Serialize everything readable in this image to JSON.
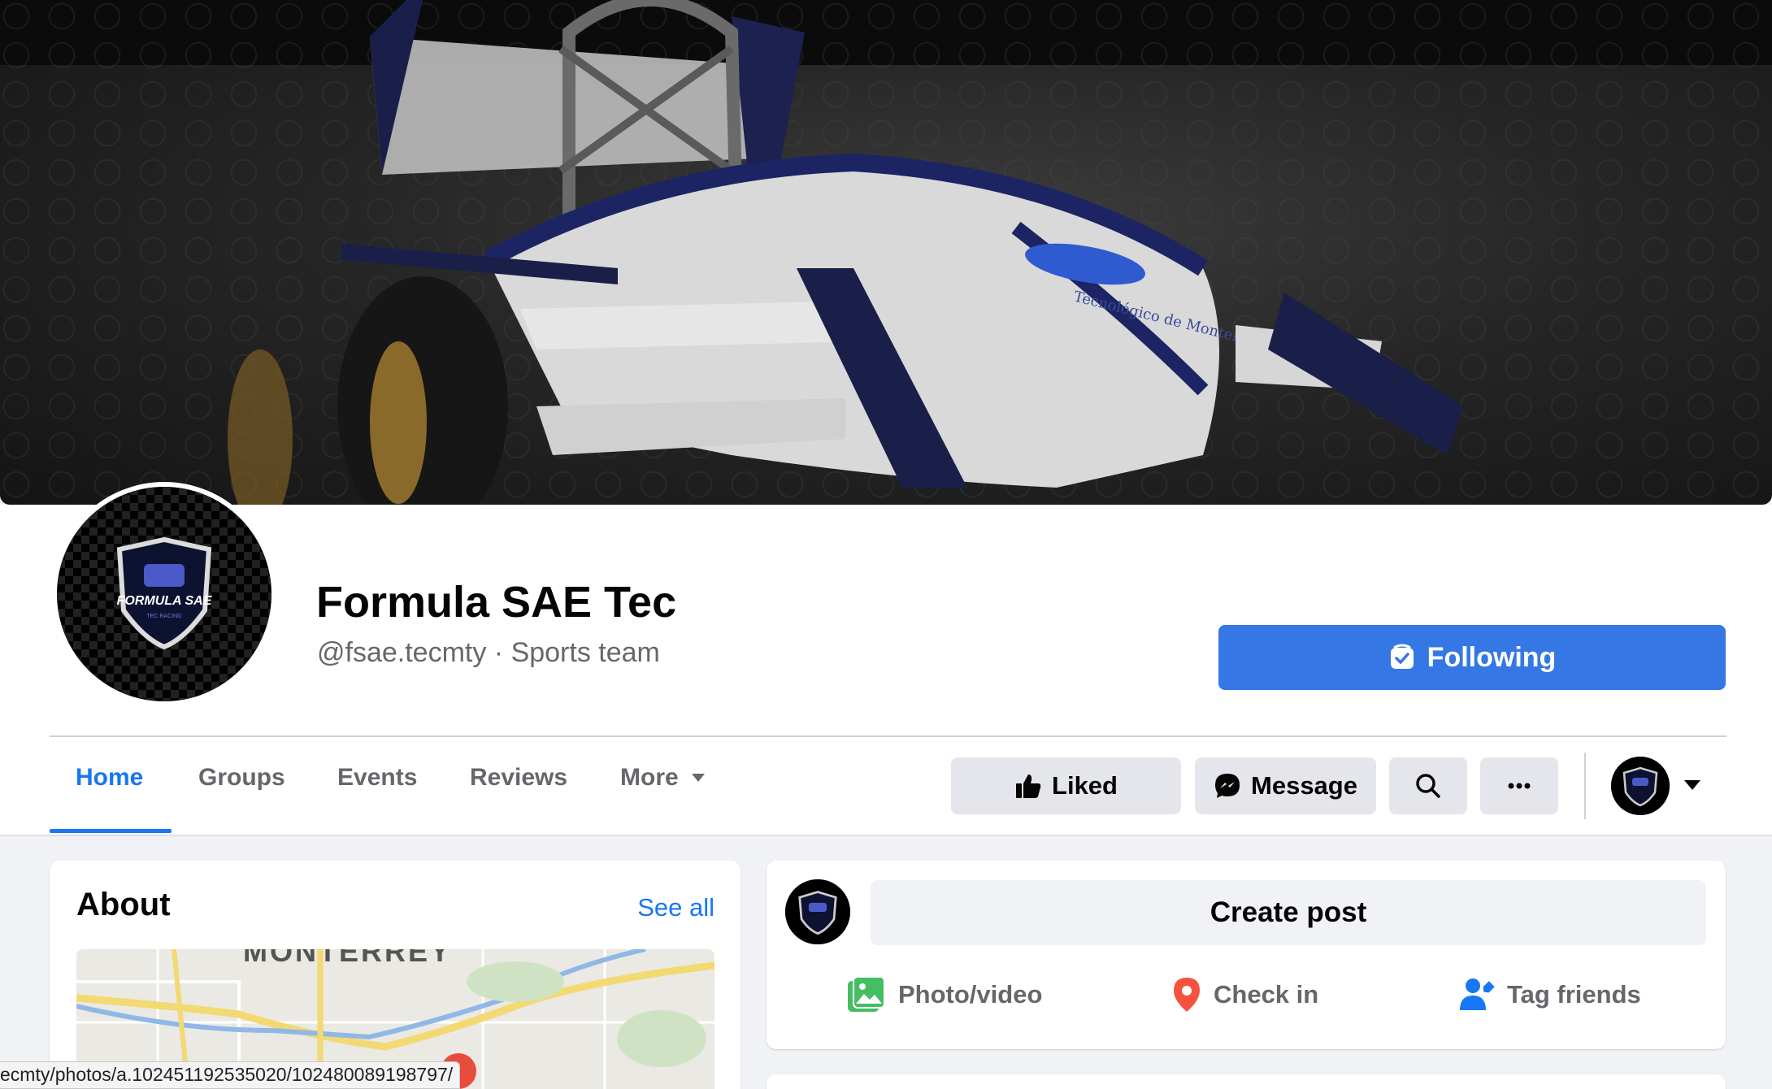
{
  "page": {
    "name": "Formula SAE Tec",
    "handle_line": "@fsae.tecmty · Sports team",
    "logo_text": "FORMULA SAE",
    "logo_subtext": "TEC RACING",
    "cover_text": "Tecnológico de Monterrey"
  },
  "header": {
    "following_label": "Following",
    "tabs": [
      {
        "label": "Home",
        "active": true
      },
      {
        "label": "Groups"
      },
      {
        "label": "Events"
      },
      {
        "label": "Reviews"
      },
      {
        "label": "More"
      }
    ],
    "liked_label": "Liked",
    "message_label": "Message"
  },
  "about": {
    "title": "About",
    "see_all": "See all",
    "map_label": "MONTERREY"
  },
  "composer": {
    "create_post_label": "Create post",
    "actions": [
      {
        "label": "Photo/video",
        "icon": "photo-icon",
        "color": "#45bd62"
      },
      {
        "label": "Check in",
        "icon": "location-pin-icon",
        "color": "#f5533d"
      },
      {
        "label": "Tag friends",
        "icon": "tag-friends-icon",
        "color": "#1877f2"
      }
    ]
  },
  "status_bar": {
    "url": "ecmty/photos/a.102451192535020/102480089198797/"
  },
  "colors": {
    "accent": "#1877f2",
    "following_button": "#3578e5"
  }
}
